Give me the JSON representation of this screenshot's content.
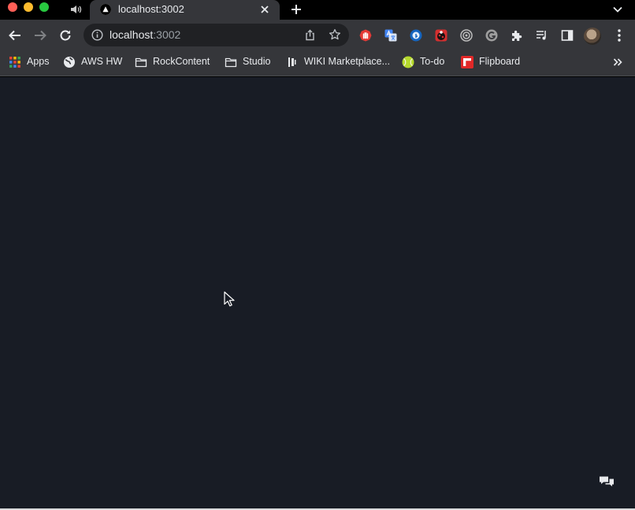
{
  "tab": {
    "title": "localhost:3002"
  },
  "address_bar": {
    "host": "localhost",
    "port": ":3002"
  },
  "bookmarks": [
    {
      "label": "Apps",
      "icon": "apps-grid-icon"
    },
    {
      "label": "AWS HW",
      "icon": "globe-icon"
    },
    {
      "label": "RockContent",
      "icon": "folder-icon"
    },
    {
      "label": "Studio",
      "icon": "folder-icon"
    },
    {
      "label": "WIKI Marketplace...",
      "icon": "wiki-icon"
    },
    {
      "label": "To-do",
      "icon": "tennis-ball-icon"
    },
    {
      "label": "Flipboard",
      "icon": "flipboard-icon"
    }
  ],
  "extensions": [
    "stop-hand-icon",
    "translate-icon",
    "lock-key-icon",
    "ladybug-icon",
    "target-icon",
    "grammarly-icon",
    "puzzle-icon",
    "queue-icon",
    "side-panel-icon"
  ],
  "colors": {
    "page_background": "#181c25",
    "browser_chrome": "#35363a",
    "tab_strip": "#000000"
  }
}
